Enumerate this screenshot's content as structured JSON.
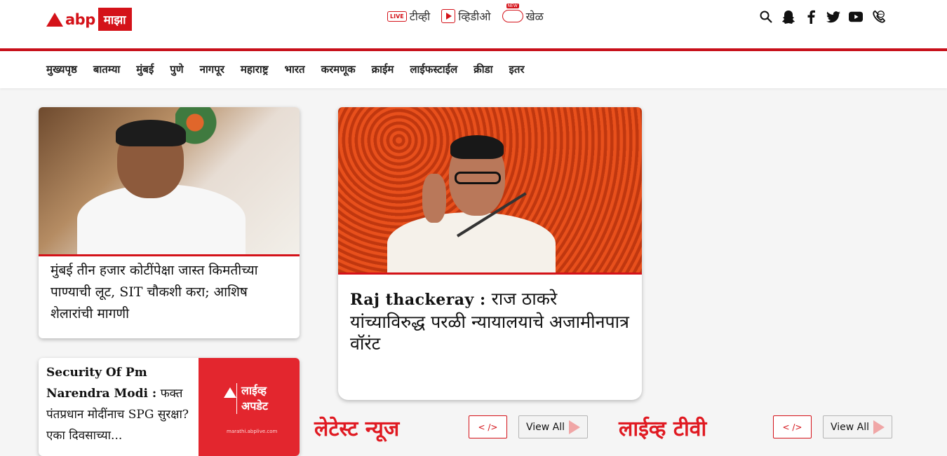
{
  "header": {
    "logo_abp": "abp",
    "logo_box": "माझा",
    "top_links": [
      {
        "icon": "live-icon",
        "icon_text": "LIVE",
        "label": "टीव्ही"
      },
      {
        "icon": "video-play-icon",
        "label": "व्हिडीओ"
      },
      {
        "icon": "gamepad-icon",
        "label": "खेळ"
      }
    ],
    "social_icons": [
      "search-icon",
      "snapchat-icon",
      "facebook-icon",
      "twitter-icon",
      "youtube-icon",
      "whatsapp-icon"
    ]
  },
  "nav": {
    "items": [
      "मुख्यपृष्ठ",
      "बातम्या",
      "मुंबई",
      "पुणे",
      "नागपूर",
      "महाराष्ट्र",
      "भारत",
      "करमणूक",
      "क्राईम",
      "लाईफस्टाईल",
      "क्रीडा",
      "इतर"
    ]
  },
  "cards": {
    "left_top": {
      "title": "मुंबई तीन हजार कोटींपेक्षा जास्त किमतीच्या पाण्याची लूट, SIT चौकशी करा; आशिष शेलारांची मागणी"
    },
    "left_bottom": {
      "title_en": "Security Of Pm Narendra Modi :",
      "title_mr": "फक्त पंतप्रधान मोदींनाच SPG सुरक्षा? एका दिवसाच्या...",
      "thumb_text": "लाईव्ह अपडेट",
      "thumb_small": "marathi.abplive.com",
      "thumb_logo": "abp माझा"
    },
    "main": {
      "title_en": "Raj thackeray :",
      "title_mr": "राज ठाकरे यांच्याविरुद्ध परळी न्यायालयाचे अजामीनपात्र वॉरंट"
    }
  },
  "sections": {
    "latest": {
      "title": "लेटेस्ट न्यूज",
      "arrows": "< />",
      "view_all": "View All"
    },
    "live_tv": {
      "title": "लाईव्ह टीवी",
      "arrows": "< />",
      "view_all": "View All"
    }
  },
  "colors": {
    "brand_red": "#d41219",
    "section_red": "#e01a22"
  }
}
